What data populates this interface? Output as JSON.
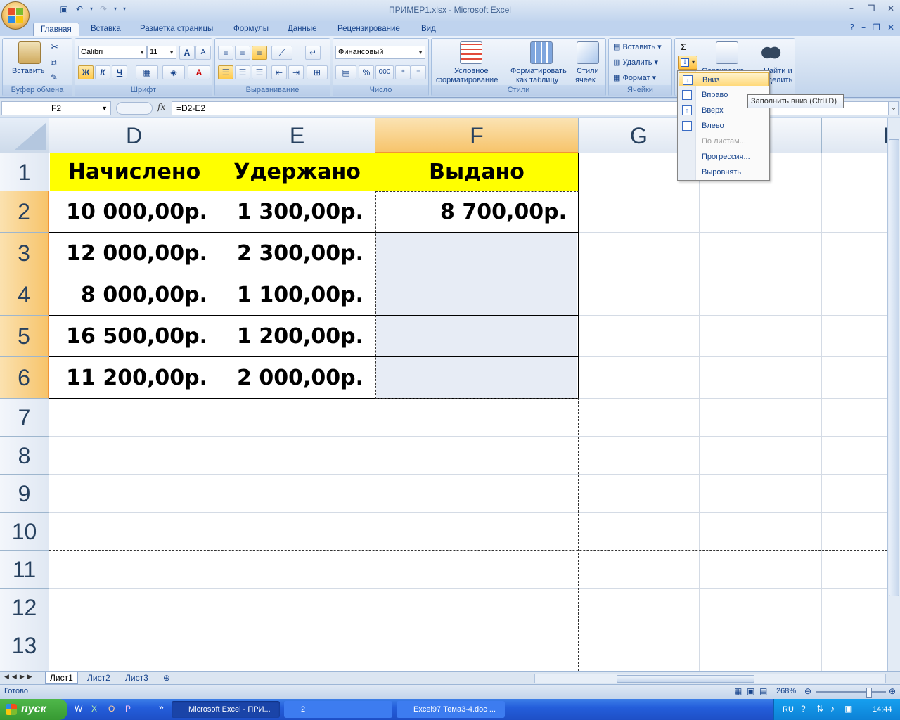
{
  "window": {
    "title": "ПРИМЕР1.xlsx - Microsoft Excel"
  },
  "tabs": [
    "Главная",
    "Вставка",
    "Разметка страницы",
    "Формулы",
    "Данные",
    "Рецензирование",
    "Вид"
  ],
  "ribbon": {
    "clipboard": {
      "label": "Буфер обмена",
      "paste": "Вставить"
    },
    "font": {
      "label": "Шрифт",
      "name": "Calibri",
      "size": "11",
      "bold": "Ж",
      "italic": "К",
      "underline": "Ч",
      "grow": "A",
      "shrink": "A"
    },
    "alignment": {
      "label": "Выравнивание"
    },
    "number": {
      "label": "Число",
      "format": "Финансовый",
      "percent": "%",
      "thousands": "000"
    },
    "styles": {
      "label": "Стили",
      "cond_line1": "Условное",
      "cond_line2": "форматирование",
      "table_line1": "Форматировать",
      "table_line2": "как таблицу",
      "cell_line1": "Стили",
      "cell_line2": "ячеек"
    },
    "cells": {
      "label": "Ячейки",
      "insert": "Вставить",
      "delete": "Удалить",
      "format": "Формат"
    },
    "editing": {
      "sum": "Σ",
      "sort_partial": "Сортировка",
      "find_line1": "Найти и",
      "find_line2": "выделить"
    }
  },
  "formula_bar": {
    "name_box": "F2",
    "fx": "fx",
    "formula": "=D2-E2"
  },
  "columns": [
    "D",
    "E",
    "F",
    "G",
    "I"
  ],
  "rows": [
    "1",
    "2",
    "3",
    "4",
    "5",
    "6",
    "7",
    "8",
    "9",
    "10",
    "11",
    "12",
    "13"
  ],
  "table": {
    "headers": [
      "Начислено",
      "Удержано",
      "Выдано"
    ],
    "data": [
      [
        "10 000,00р.",
        "1 300,00р.",
        "8 700,00р."
      ],
      [
        "12 000,00р.",
        "2 300,00р.",
        ""
      ],
      [
        "8 000,00р.",
        "1 100,00р.",
        ""
      ],
      [
        "16 500,00р.",
        "1 200,00р.",
        ""
      ],
      [
        "11 200,00р.",
        "2 000,00р.",
        ""
      ]
    ]
  },
  "fill_menu": {
    "items": [
      "Вниз",
      "Вправо",
      "Вверх",
      "Влево",
      "По листам...",
      "Прогрессия...",
      "Выровнять"
    ],
    "disabled_index": 4,
    "highlighted_index": 0,
    "tooltip": "Заполнить вниз (Ctrl+D)"
  },
  "sheets": [
    "Лист1",
    "Лист2",
    "Лист3"
  ],
  "status": {
    "ready": "Готово",
    "zoom": "268%"
  },
  "taskbar": {
    "start": "пуск",
    "tasks": [
      "Microsoft Excel - ПРИ...",
      "2",
      "Excel97 Тема3-4.doc ..."
    ],
    "lang": "RU",
    "time": "14:44"
  },
  "colors": {
    "header_fill": "#ffff00",
    "selection": "#f7c46b",
    "accent": "#15428b"
  }
}
